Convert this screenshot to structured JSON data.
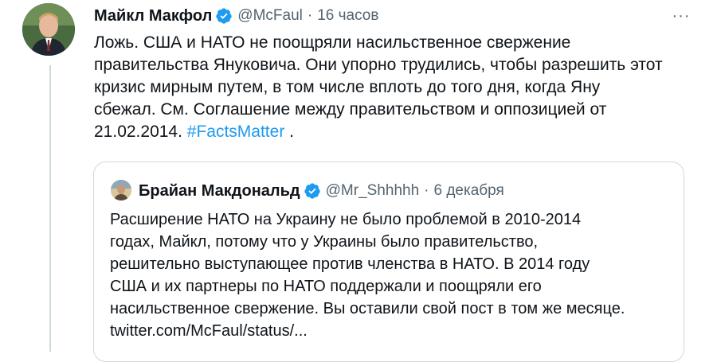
{
  "tweet": {
    "author_name": "Майкл Макфол",
    "handle": "@McFaul",
    "separator": "·",
    "time": "16 часов",
    "more_label": "···",
    "text_lines": [
      "Ложь. США и НАТО не поощряли насильственное свержение",
      "правительства Януковича. Они упорно трудились, чтобы разрешить этот",
      "кризис мирным путем, в том числе вплоть до того дня, когда Яну",
      "сбежал. См. Соглашение между правительством и оппозицией от"
    ],
    "last_line_prefix": "21.02.2014. ",
    "hashtag": "#FactsMatter",
    "last_line_suffix": " ."
  },
  "quoted_tweet": {
    "author_name": "Брайан Макдональд",
    "handle": "@Mr_Shhhhh",
    "separator": "·",
    "time": "6 декабря",
    "text_lines": [
      "Расширение НАТО на Украину не было проблемой в 2010-2014",
      "годах, Майкл, потому что у Украины было правительство,",
      "решительно выступающее против членства в НАТО. В 2014 году",
      "США и их партнеры по НАТО поддержали и поощряли его",
      "насильственное свержение. Вы оставили свой пост в том же месяце.",
      "twitter.com/McFaul/status/..."
    ]
  },
  "colors": {
    "link": "#1d9bf0",
    "muted": "#536471",
    "text": "#0f1419",
    "border": "#cfd9de"
  },
  "icons": [
    "verified-badge-icon",
    "more-options-icon"
  ]
}
